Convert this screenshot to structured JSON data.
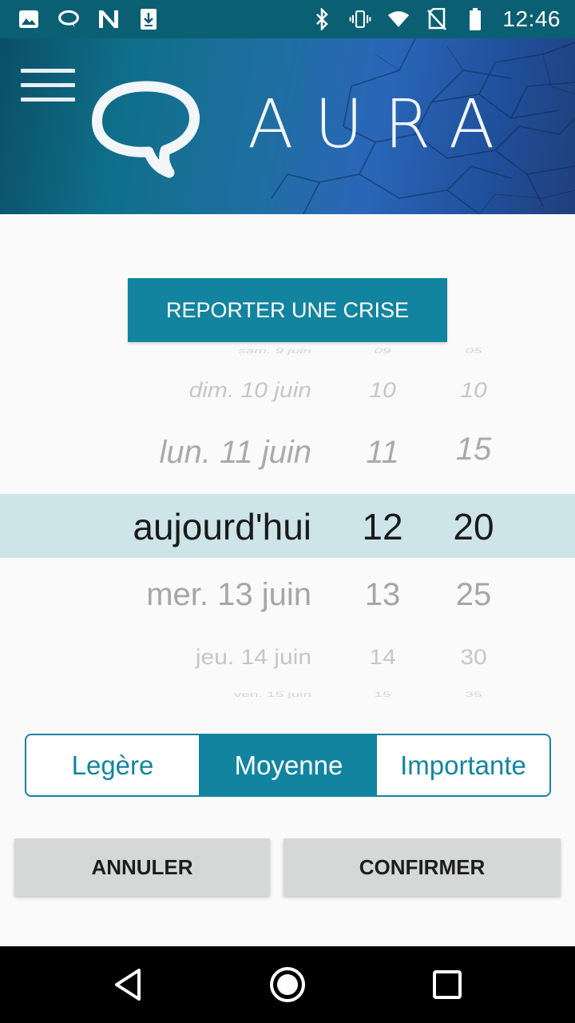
{
  "status_bar": {
    "time": "12:46",
    "left_icons": [
      "image-icon",
      "chat-bubble-icon",
      "n-logo-icon",
      "download-icon"
    ],
    "right_icons": [
      "bluetooth-icon",
      "vibrate-icon",
      "wifi-icon",
      "no-sim-icon",
      "battery-icon"
    ]
  },
  "header": {
    "app_name": "AURA",
    "menu_icon": "hamburger-menu-icon",
    "logo_icon": "speech-bubble-logo-icon"
  },
  "report_button": {
    "label": "REPORTER UNE CRISE"
  },
  "picker": {
    "dates": [
      "sam. 9 juin",
      "dim. 10 juin",
      "lun. 11 juin",
      "aujourd'hui",
      "mer. 13 juin",
      "jeu. 14 juin",
      "ven. 15 juin"
    ],
    "hours": [
      "09",
      "10",
      "11",
      "12",
      "13",
      "14",
      "15"
    ],
    "minutes": [
      "05",
      "10",
      "15",
      "20",
      "25",
      "30",
      "35"
    ],
    "selected": {
      "date": "aujourd'hui",
      "hour": "12",
      "minute": "20"
    }
  },
  "severity": {
    "options": [
      "Legère",
      "Moyenne",
      "Importante"
    ],
    "selected": "Moyenne"
  },
  "actions": {
    "cancel": "ANNULER",
    "confirm": "CONFIRMER"
  },
  "colors": {
    "accent": "#13849f",
    "status_bar": "#0b5f72",
    "picker_highlight": "#cde4e8",
    "button_gray": "#d6d7d7"
  },
  "nav_bar": {
    "icons": [
      "back-icon",
      "home-icon",
      "recents-icon"
    ]
  }
}
